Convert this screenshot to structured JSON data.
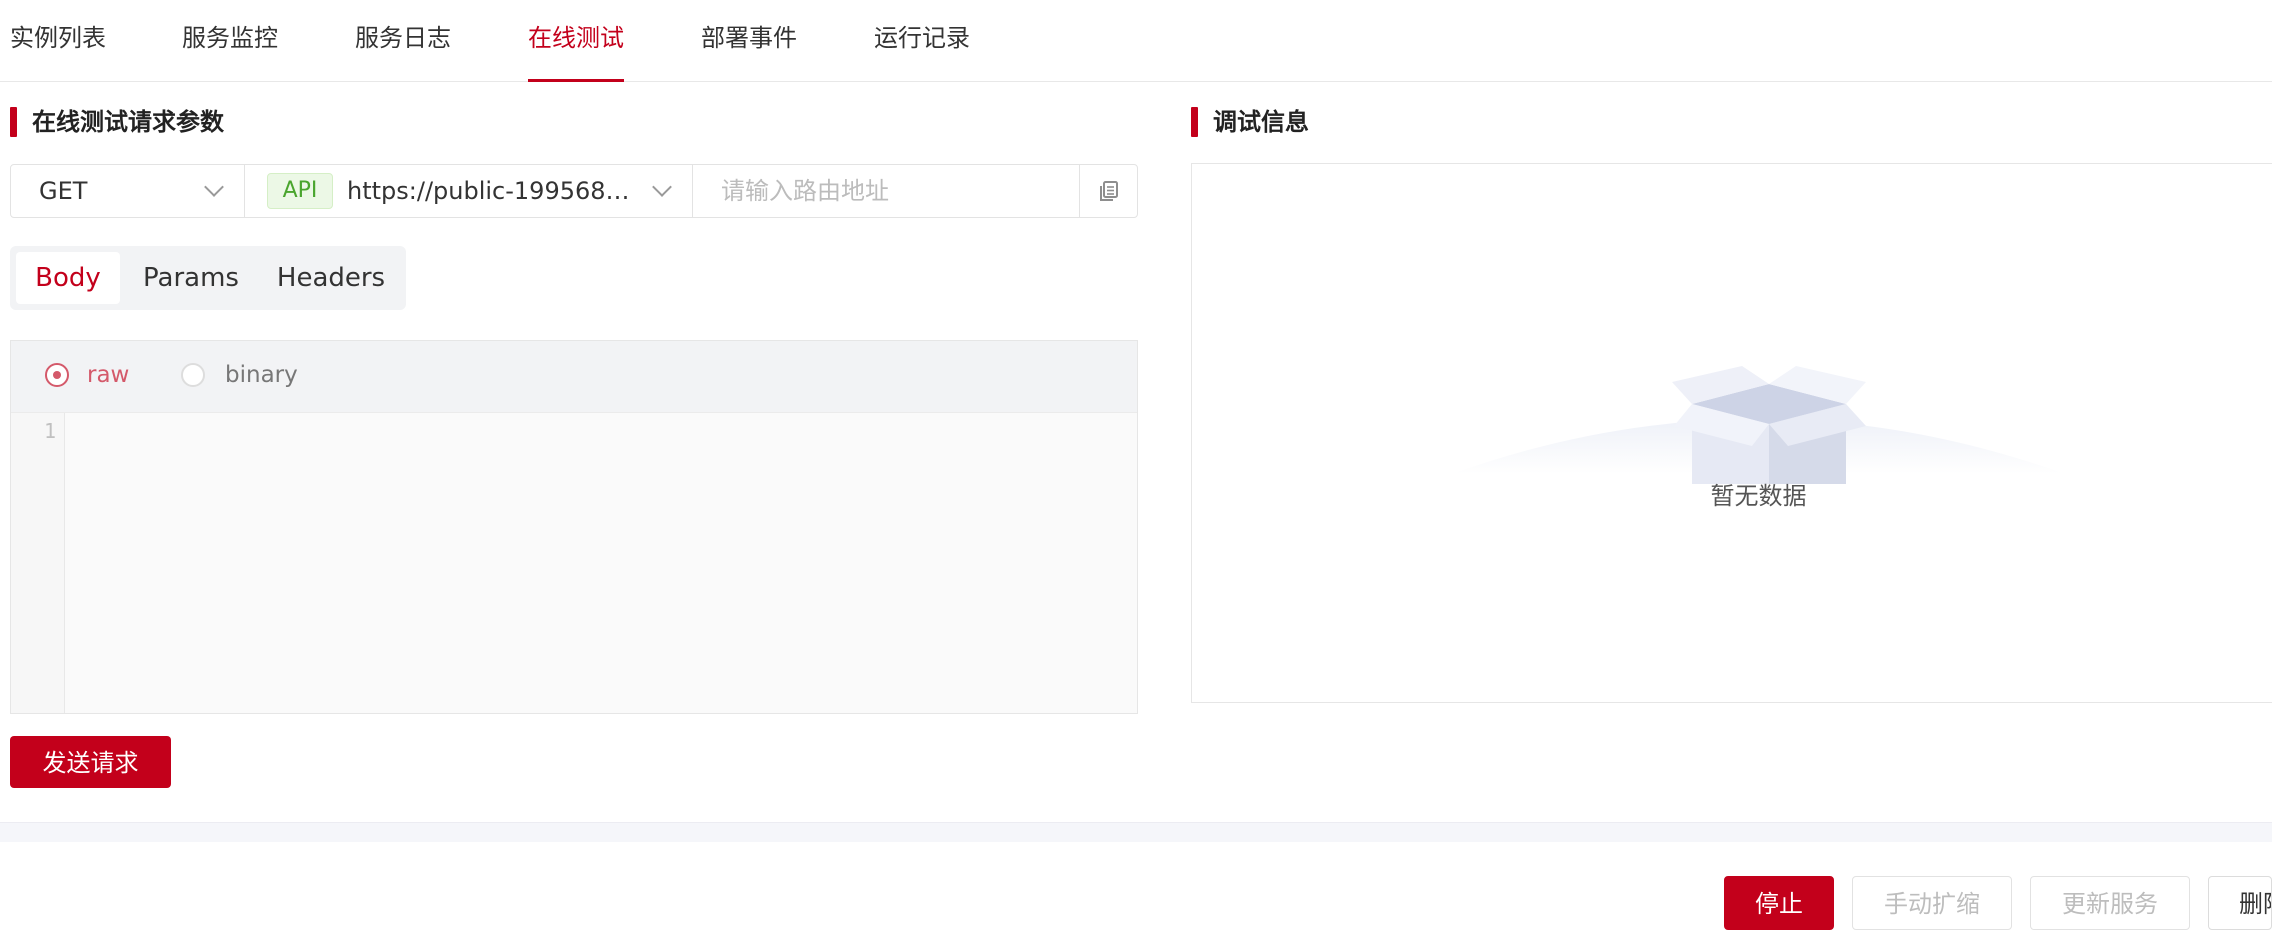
{
  "tabs": [
    {
      "label": "实例列表",
      "active": false
    },
    {
      "label": "服务监控",
      "active": false
    },
    {
      "label": "服务日志",
      "active": false
    },
    {
      "label": "在线测试",
      "active": true
    },
    {
      "label": "部署事件",
      "active": false
    },
    {
      "label": "运行记录",
      "active": false
    }
  ],
  "request": {
    "section_title": "在线测试请求参数",
    "method": "GET",
    "api_badge": "API",
    "url": "https://public-19956842…",
    "route_placeholder": "请输入路由地址",
    "body_tabs": [
      {
        "label": "Body",
        "active": true
      },
      {
        "label": "Params",
        "active": false
      },
      {
        "label": "Headers",
        "active": false
      }
    ],
    "body_types": [
      {
        "label": "raw",
        "checked": true
      },
      {
        "label": "binary",
        "checked": false
      }
    ],
    "line_number": "1",
    "send_label": "发送请求"
  },
  "debug": {
    "section_title": "调试信息",
    "empty_text": "暂无数据"
  },
  "footer": {
    "buttons": [
      {
        "label": "停止",
        "state": "primary"
      },
      {
        "label": "手动扩缩",
        "state": "disabled"
      },
      {
        "label": "更新服务",
        "state": "disabled"
      },
      {
        "label": "删除",
        "state": "normal"
      }
    ]
  },
  "colors": {
    "accent": "#c3001b",
    "api_badge_bg": "#ecf8e6",
    "api_badge_text": "#4aa52e"
  },
  "icons": {
    "copy": "copy-icon",
    "chevron": "chevron-down-icon",
    "empty": "empty-box-icon"
  }
}
